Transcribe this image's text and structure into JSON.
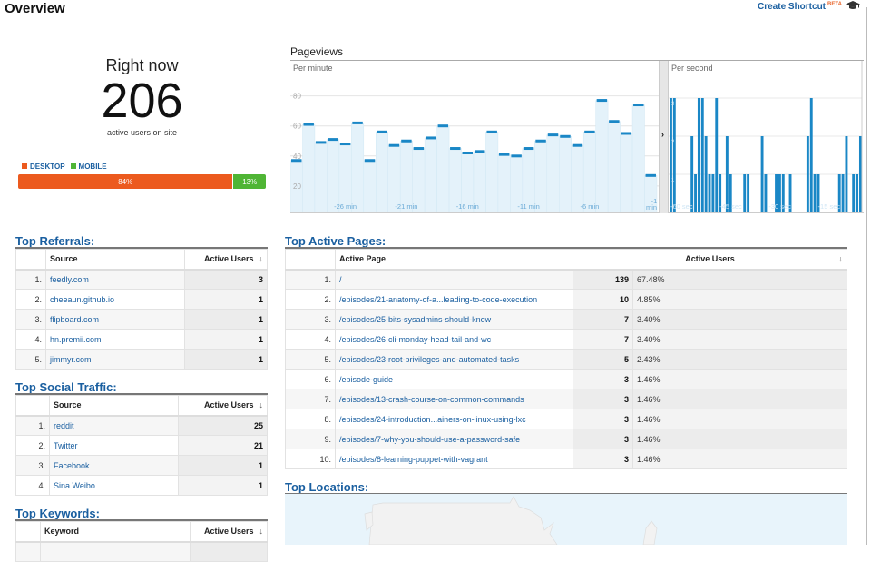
{
  "header": {
    "title": "Overview",
    "shortcut_label": "Create Shortcut",
    "shortcut_badge": "BETA",
    "help_icon": "graduation-cap-icon"
  },
  "right_now": {
    "label": "Right now",
    "active_users": "206",
    "sublabel": "active users on site",
    "legend": [
      {
        "label": "DESKTOP",
        "color": "#ec5a1e"
      },
      {
        "label": "MOBILE",
        "color": "#4fb535"
      }
    ],
    "device_split": [
      {
        "label": "84%",
        "percent": 84,
        "color": "#ec5a1e"
      },
      {
        "label": "13%",
        "percent": 13,
        "color": "#4fb535"
      }
    ]
  },
  "pageviews": {
    "title": "Pageviews",
    "expand_icon": "chevron-right-icon"
  },
  "chart_data": [
    {
      "type": "bar",
      "title": "Per minute",
      "xlabel": "",
      "ylabel": "",
      "ylim": [
        0,
        80
      ],
      "yticks": [
        20,
        40,
        60,
        80
      ],
      "xtick_labels": [
        "-26 min",
        "-21 min",
        "-16 min",
        "-11 min",
        "-6 min",
        "-1 min"
      ],
      "xtick_index": [
        4,
        9,
        14,
        19,
        24,
        29
      ],
      "values": [
        37,
        61,
        49,
        51,
        48,
        62,
        37,
        56,
        47,
        50,
        45,
        52,
        60,
        45,
        42,
        43,
        56,
        41,
        40,
        45,
        50,
        54,
        53,
        47,
        56,
        77,
        63,
        55,
        74,
        27
      ],
      "grid": true,
      "color": "#1a87c6"
    },
    {
      "type": "bar",
      "title": "Per second",
      "ylim": [
        0,
        3
      ],
      "yticks": [
        1,
        2,
        3
      ],
      "xtick_labels": [
        "-60 sec",
        "-45 sec",
        "-30 sec",
        "-15 sec"
      ],
      "xtick_index": [
        0,
        14,
        28,
        42
      ],
      "values": [
        3,
        3,
        0,
        0,
        0,
        0,
        2,
        1,
        3,
        3,
        2,
        1,
        1,
        3,
        1,
        0,
        2,
        1,
        0,
        0,
        0,
        1,
        1,
        0,
        0,
        0,
        2,
        1,
        0,
        0,
        1,
        1,
        1,
        0,
        1,
        0,
        0,
        0,
        0,
        2,
        3,
        1,
        1,
        0,
        0,
        0,
        0,
        0,
        1,
        1,
        2,
        0,
        1,
        1,
        2
      ],
      "grid": true,
      "color": "#1a87c6"
    }
  ],
  "top_referrals": {
    "title": "Top Referrals:",
    "columns": [
      "Source",
      "Active Users"
    ],
    "rows": [
      {
        "rank": "1.",
        "name": "feedly.com",
        "value": "3"
      },
      {
        "rank": "2.",
        "name": "cheeaun.github.io",
        "value": "1"
      },
      {
        "rank": "3.",
        "name": "flipboard.com",
        "value": "1"
      },
      {
        "rank": "4.",
        "name": "hn.premii.com",
        "value": "1"
      },
      {
        "rank": "5.",
        "name": "jimmyr.com",
        "value": "1"
      }
    ]
  },
  "top_social": {
    "title": "Top Social Traffic:",
    "columns": [
      "Source",
      "Active Users"
    ],
    "rows": [
      {
        "rank": "1.",
        "name": "reddit",
        "value": "25"
      },
      {
        "rank": "2.",
        "name": "Twitter",
        "value": "21"
      },
      {
        "rank": "3.",
        "name": "Facebook",
        "value": "1"
      },
      {
        "rank": "4.",
        "name": "Sina Weibo",
        "value": "1"
      }
    ]
  },
  "top_keywords": {
    "title": "Top Keywords:",
    "columns": [
      "Keyword",
      "Active Users"
    ]
  },
  "top_pages": {
    "title": "Top Active Pages:",
    "columns": [
      "Active Page",
      "Active Users"
    ],
    "rows": [
      {
        "rank": "1.",
        "name": "/",
        "value": "139",
        "pct": "67.48%"
      },
      {
        "rank": "2.",
        "name": "/episodes/21-anatomy-of-a...leading-to-code-execution",
        "value": "10",
        "pct": "4.85%"
      },
      {
        "rank": "3.",
        "name": "/episodes/25-bits-sysadmins-should-know",
        "value": "7",
        "pct": "3.40%"
      },
      {
        "rank": "4.",
        "name": "/episodes/26-cli-monday-head-tail-and-wc",
        "value": "7",
        "pct": "3.40%"
      },
      {
        "rank": "5.",
        "name": "/episodes/23-root-privileges-and-automated-tasks",
        "value": "5",
        "pct": "2.43%"
      },
      {
        "rank": "6.",
        "name": "/episode-guide",
        "value": "3",
        "pct": "1.46%"
      },
      {
        "rank": "7.",
        "name": "/episodes/13-crash-course-on-common-commands",
        "value": "3",
        "pct": "1.46%"
      },
      {
        "rank": "8.",
        "name": "/episodes/24-introduction...ainers-on-linux-using-lxc",
        "value": "3",
        "pct": "1.46%"
      },
      {
        "rank": "9.",
        "name": "/episodes/7-why-you-should-use-a-password-safe",
        "value": "3",
        "pct": "1.46%"
      },
      {
        "rank": "10.",
        "name": "/episodes/8-learning-puppet-with-vagrant",
        "value": "3",
        "pct": "1.46%"
      }
    ]
  },
  "top_locations": {
    "title": "Top Locations:"
  },
  "sort_icon": "arrow-down-icon"
}
